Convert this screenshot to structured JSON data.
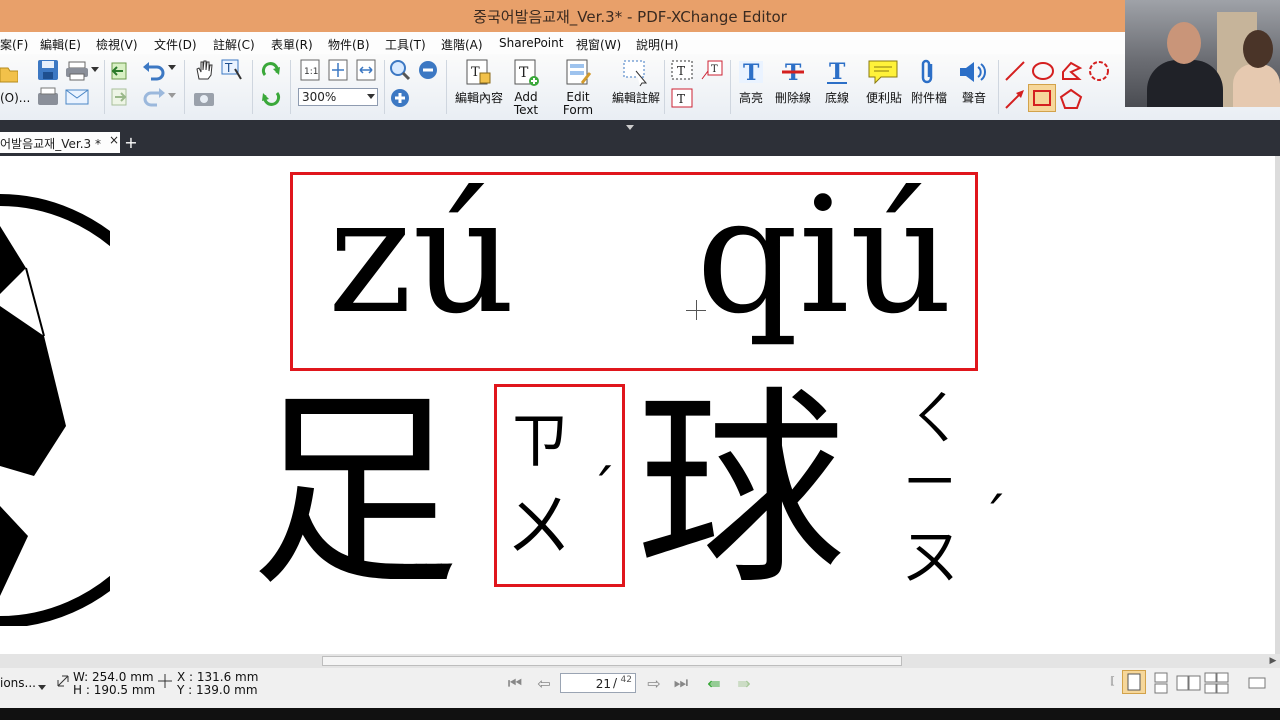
{
  "window": {
    "title": "중국어발음교재_Ver.3* - PDF-XChange Editor"
  },
  "menu": [
    "案(F)",
    "編輯(E)",
    "檢視(V)",
    "文件(D)",
    "註解(C)",
    "表單(R)",
    "物件(B)",
    "工具(T)",
    "進階(A)",
    "SharePoint",
    "視窗(W)",
    "說明(H)"
  ],
  "toolbar": {
    "open_label_fragment": "(O)...",
    "zoom_value": "300%",
    "edit_content_label": "編輯內容",
    "add_text_label_1": "Add",
    "add_text_label_2": "Text",
    "edit_form_label_1": "Edit",
    "edit_form_label_2": "Form",
    "edit_annot_label": "編輯註解",
    "highlight_label": "高亮",
    "strikeout_label": "刪除線",
    "underline_label": "底線",
    "sticky_note_label": "便利貼",
    "attach_label": "附件檔",
    "sound_label": "聲音"
  },
  "tab": {
    "name": "어발음교재_Ver.3 *",
    "close": "×",
    "new": "+"
  },
  "document": {
    "pinyin_1": "zú",
    "pinyin_2": "qiú",
    "hanzi_1": "足",
    "hanzi_2": "球",
    "bopomofo_1_top": "ㄗ",
    "bopomofo_1_bottom": "ㄨ",
    "bopomofo_1_tone": "ˊ",
    "bopomofo_2_top": "ㄑ",
    "bopomofo_2_mid": "ㄧ",
    "bopomofo_2_bottom": "ㄡ",
    "bopomofo_2_tone": "ˊ",
    "highlight_color": "#e0161c"
  },
  "status": {
    "options_label": "ions...",
    "width": "W: 254.0 mm",
    "height": "H : 190.5 mm",
    "x_coord": "X : 131.6 mm",
    "y_coord": "Y : 139.0 mm",
    "page_current": "21",
    "page_total": "42"
  }
}
